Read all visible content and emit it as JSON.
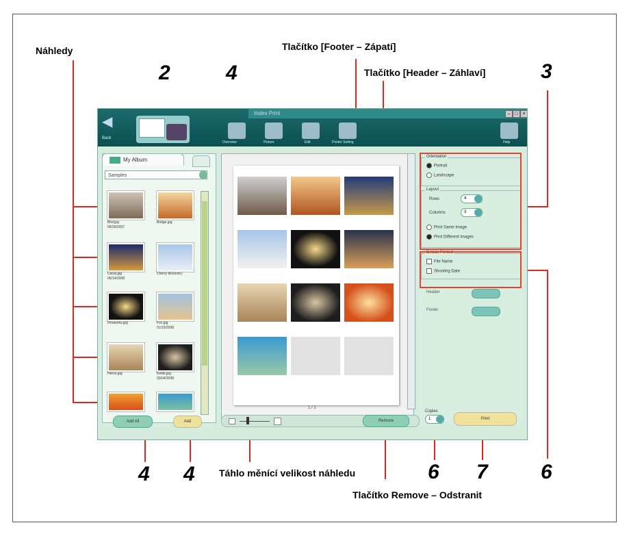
{
  "callouts": {
    "nahledy": "Náhledy",
    "footer_button": "Tlačítko [Footer – Zápatí]",
    "header_button": "Tlačítko [Header – Záhlaví]",
    "slider": "Táhlo měnící velikost náhledu",
    "remove_button": "Tlačítko Remove – Odstranit"
  },
  "numbers": {
    "n2": "2",
    "n4_top": "4",
    "n3": "3",
    "n4_a": "4",
    "n4_b": "4",
    "n6_a": "6",
    "n7": "7",
    "n6_b": "6"
  },
  "app": {
    "window_title": "Index Print",
    "back_label": "Back",
    "toolbar": [
      "Overview",
      "Picture",
      "Edit",
      "Printer Setting"
    ],
    "help_label": "Help",
    "album_tab": "My Album",
    "folder_combo": "Samples",
    "thumbnails": [
      {
        "name": "Bird.jpg",
        "date": "06/30/2007"
      },
      {
        "name": "Bridge.jpg",
        "date": ""
      },
      {
        "name": "Canal.jpg",
        "date": "06/14/2008"
      },
      {
        "name": "Cherry blossom.j",
        "date": ""
      },
      {
        "name": "Fireworks.jpg",
        "date": ""
      },
      {
        "name": "Fox.jpg",
        "date": "01/15/2008"
      },
      {
        "name": "Heron.jpg",
        "date": ""
      },
      {
        "name": "Kettle.jpg",
        "date": "03/04/2008"
      }
    ],
    "add_all_label": "Add All",
    "add_label": "Add",
    "page_indicator": "1 / 1",
    "remove_label": "Remove",
    "orientation": {
      "title": "Orientation",
      "portrait": "Portrait",
      "landscape": "Landscape"
    },
    "layout": {
      "title": "Layout",
      "rows": "Rows",
      "columns": "Columns",
      "rows_value": "4",
      "columns_value": "3",
      "same": "Print Same Image",
      "different": "Print Different Images"
    },
    "details": {
      "title": "Details Printed",
      "file_name": "File Name",
      "shooting_date": "Shooting Date"
    },
    "header_label": "Header",
    "footer_label": "Footer",
    "copies_label": "Copies",
    "copies_value": "1",
    "print_label": "Print"
  },
  "colors": {
    "titlebar": "#0c4f52",
    "accent": "#e8412c",
    "pane": "#d6ecdf"
  }
}
